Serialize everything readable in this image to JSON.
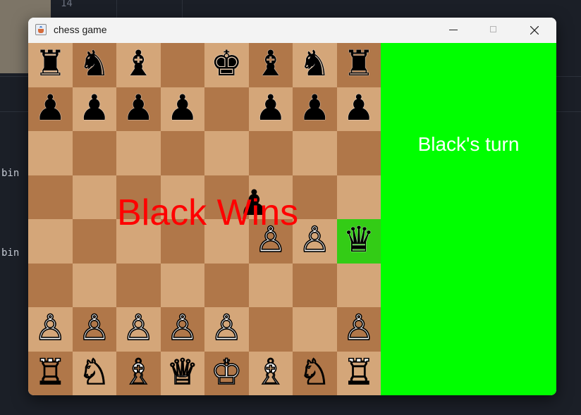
{
  "background": {
    "line_number": "14",
    "side_labels": [
      "bin",
      "bin"
    ]
  },
  "window": {
    "title": "chess game",
    "controls": {
      "minimize": "minimize",
      "maximize": "maximize",
      "close": "close"
    }
  },
  "board": {
    "rows": [
      [
        "♜",
        "♞",
        "♝",
        "",
        "♚",
        "♝",
        "♞",
        "♜"
      ],
      [
        "♟",
        "♟",
        "♟",
        "♟",
        "",
        "♟",
        "♟",
        "♟"
      ],
      [
        "",
        "",
        "",
        "",
        "",
        "",
        "",
        ""
      ],
      [
        "",
        "",
        "",
        "",
        "",
        "",
        "",
        ""
      ],
      [
        "",
        "",
        "",
        "",
        "",
        "♙",
        "♙",
        "♛"
      ],
      [
        "",
        "",
        "",
        "",
        "",
        "",
        "",
        ""
      ],
      [
        "♙",
        "♙",
        "♙",
        "♙",
        "♙",
        "",
        "",
        "♙"
      ],
      [
        "♖",
        "♘",
        "♗",
        "♕",
        "♔",
        "♗",
        "♘",
        "♖"
      ]
    ],
    "highlight": {
      "row": 4,
      "col": 7
    },
    "stray_piece": "♟",
    "light_color": "#d4a679",
    "dark_color": "#b07749",
    "highlight_color": "#33cc16"
  },
  "status": {
    "result_message": "Black Wins",
    "turn": "Black's turn",
    "panel_color": "#00ff00",
    "message_color": "#ff0000"
  }
}
